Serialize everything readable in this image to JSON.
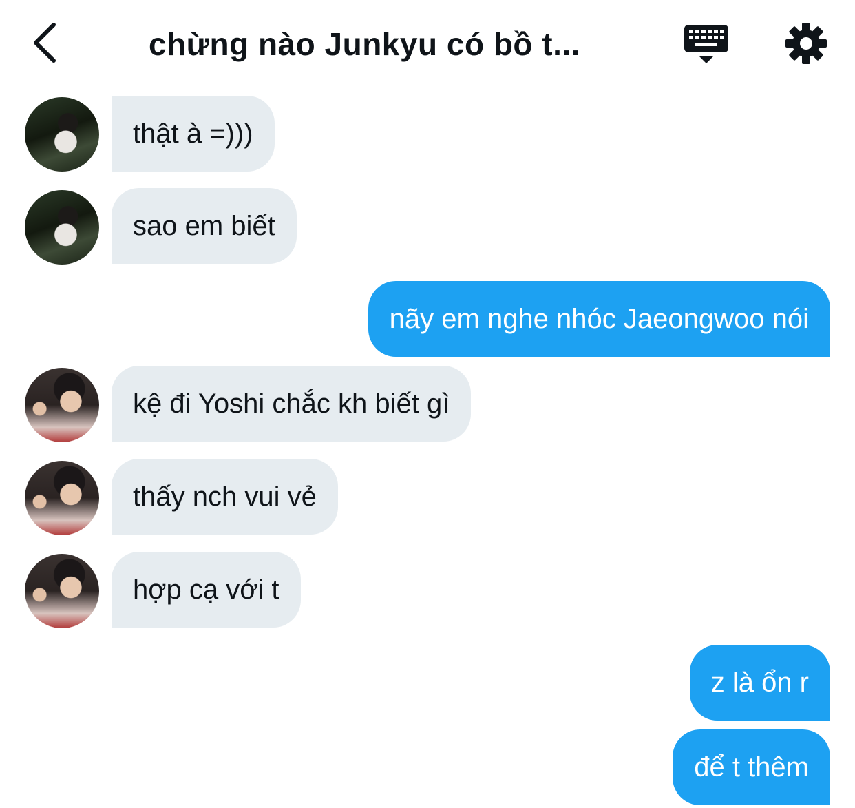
{
  "header": {
    "title": "chừng nào Junkyu có bồ t...",
    "back_icon": "chevron-left-icon",
    "keyboard_icon": "keyboard-icon",
    "settings_icon": "gear-icon"
  },
  "messages": [
    {
      "direction": "incoming",
      "sender": "avatar-1",
      "text": "thật à =)))"
    },
    {
      "direction": "incoming",
      "sender": "avatar-1",
      "text": "sao em biết"
    },
    {
      "direction": "outgoing",
      "text": "nãy em nghe nhóc Jaeongwoo nói"
    },
    {
      "direction": "incoming",
      "sender": "avatar-2",
      "text": "kệ đi Yoshi chắc kh biết gì"
    },
    {
      "direction": "incoming",
      "sender": "avatar-2",
      "text": "thấy nch vui vẻ"
    },
    {
      "direction": "incoming",
      "sender": "avatar-2",
      "text": "hợp cạ với t"
    },
    {
      "direction": "outgoing",
      "text": "z là ổn r"
    },
    {
      "direction": "outgoing",
      "text": "để t thêm"
    }
  ],
  "colors": {
    "incoming_bubble": "#e6ecf0",
    "outgoing_bubble": "#1da1f2",
    "text": "#0f1419"
  }
}
